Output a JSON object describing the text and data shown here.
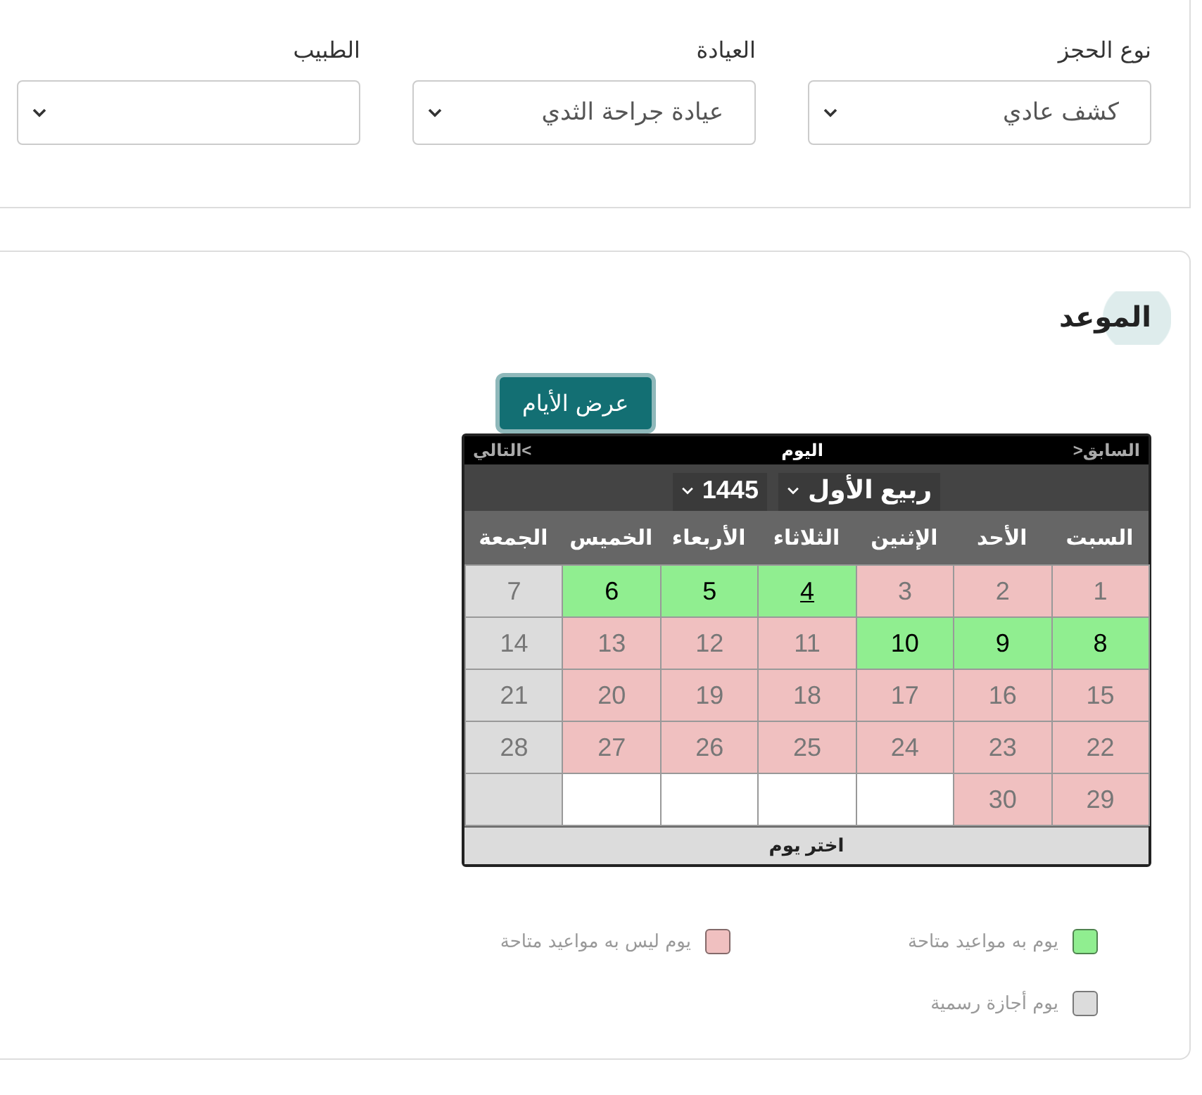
{
  "booking": {
    "fields": [
      {
        "label": "نوع الحجز",
        "value": "كشف عادي"
      },
      {
        "label": "العيادة",
        "value": "عيادة جراحة الثدي"
      },
      {
        "label": "الطبيب"
      }
    ]
  },
  "appointment": {
    "title": "الموعد",
    "show_days_button": "عرض الأيام",
    "calendar": {
      "prev": "السابق<",
      "today": "اليوم",
      "next": ">التالي",
      "month": "ربيع الأول",
      "year": "1445",
      "weekdays": [
        "السبت",
        "الأحد",
        "الإثنين",
        "الثلاثاء",
        "الأربعاء",
        "الخميس",
        "الجمعة"
      ],
      "weeks": [
        [
          {
            "day": "1",
            "kind": "unavailable",
            "today": false
          },
          {
            "day": "2",
            "kind": "unavailable",
            "today": false
          },
          {
            "day": "3",
            "kind": "unavailable",
            "today": false
          },
          {
            "day": "4",
            "kind": "available",
            "today": true
          },
          {
            "day": "5",
            "kind": "available",
            "today": false
          },
          {
            "day": "6",
            "kind": "available",
            "today": false
          },
          {
            "day": "7",
            "kind": "holiday",
            "today": false
          }
        ],
        [
          {
            "day": "8",
            "kind": "available",
            "today": false
          },
          {
            "day": "9",
            "kind": "available",
            "today": false
          },
          {
            "day": "10",
            "kind": "available",
            "today": false
          },
          {
            "day": "11",
            "kind": "unavailable",
            "today": false
          },
          {
            "day": "12",
            "kind": "unavailable",
            "today": false
          },
          {
            "day": "13",
            "kind": "unavailable",
            "today": false
          },
          {
            "day": "14",
            "kind": "holiday",
            "today": false
          }
        ],
        [
          {
            "day": "15",
            "kind": "unavailable",
            "today": false
          },
          {
            "day": "16",
            "kind": "unavailable",
            "today": false
          },
          {
            "day": "17",
            "kind": "unavailable",
            "today": false
          },
          {
            "day": "18",
            "kind": "unavailable",
            "today": false
          },
          {
            "day": "19",
            "kind": "unavailable",
            "today": false
          },
          {
            "day": "20",
            "kind": "unavailable",
            "today": false
          },
          {
            "day": "21",
            "kind": "holiday",
            "today": false
          }
        ],
        [
          {
            "day": "22",
            "kind": "unavailable",
            "today": false
          },
          {
            "day": "23",
            "kind": "unavailable",
            "today": false
          },
          {
            "day": "24",
            "kind": "unavailable",
            "today": false
          },
          {
            "day": "25",
            "kind": "unavailable",
            "today": false
          },
          {
            "day": "26",
            "kind": "unavailable",
            "today": false
          },
          {
            "day": "27",
            "kind": "unavailable",
            "today": false
          },
          {
            "day": "28",
            "kind": "holiday",
            "today": false
          }
        ],
        [
          {
            "day": "29",
            "kind": "unavailable",
            "today": false
          },
          {
            "day": "30",
            "kind": "unavailable",
            "today": false
          },
          {
            "kind": "empty"
          },
          {
            "kind": "empty"
          },
          {
            "kind": "empty"
          },
          {
            "kind": "empty"
          },
          {
            "kind": "holiday"
          }
        ]
      ],
      "footer": "اختر يوم"
    },
    "legend": [
      {
        "label": "يوم به مواعيد متاحة",
        "color": "#90ee90"
      },
      {
        "label": "يوم ليس به مواعيد متاحة",
        "color": "#f0c0c0"
      },
      {
        "label": "يوم أجازة رسمية",
        "color": "#dcdcdc"
      }
    ]
  }
}
